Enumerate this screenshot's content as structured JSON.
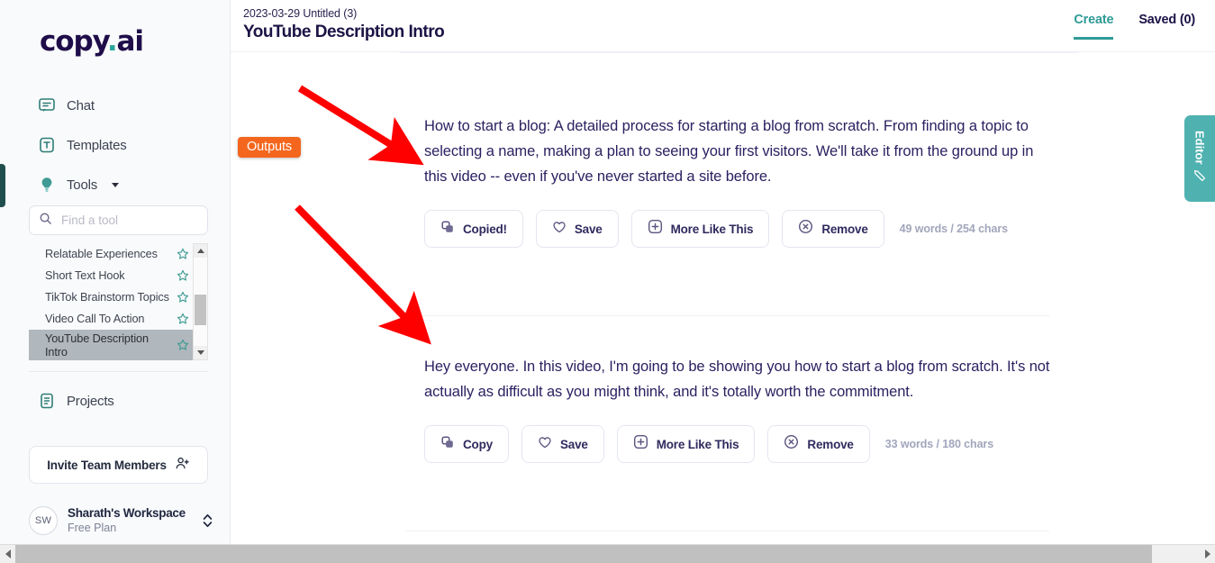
{
  "app": {
    "logo_text": "copy",
    "logo_dot": ".",
    "logo_suffix": "ai"
  },
  "sidebar": {
    "nav_items": [
      {
        "label": "Chat",
        "icon": "chat-icon"
      },
      {
        "label": "Templates",
        "icon": "templates-icon"
      },
      {
        "label": "Tools",
        "icon": "bulb-icon",
        "has_chevron": true
      }
    ],
    "search": {
      "placeholder": "Find a tool",
      "value": "",
      "icon": "search-icon"
    },
    "tools": [
      {
        "label": "Relatable Experiences",
        "favorited": false,
        "selected": false
      },
      {
        "label": "Short Text Hook",
        "favorited": false,
        "selected": false
      },
      {
        "label": "TikTok Brainstorm Topics",
        "favorited": false,
        "selected": false
      },
      {
        "label": "Video Call To Action",
        "favorited": false,
        "selected": false
      },
      {
        "label": "YouTube Description Intro",
        "favorited": false,
        "selected": true
      }
    ],
    "projects": {
      "label": "Projects",
      "icon": "document-icon"
    },
    "invite": {
      "label": "Invite Team Members",
      "icon": "add-user-icon"
    },
    "workspace": {
      "initials": "SW",
      "name": "Sharath's Workspace",
      "plan": "Free Plan"
    }
  },
  "header": {
    "doc_meta": "2023-03-29 Untitled (3)",
    "doc_title": "YouTube Description Intro",
    "tabs": [
      {
        "label": "Create",
        "active": true
      },
      {
        "label": "Saved (0)",
        "active": false
      }
    ]
  },
  "annotations": {
    "outputs_badge": "Outputs",
    "badge_color": "#f4661e",
    "arrow_color": "#ff0000"
  },
  "editor_panel": {
    "label": "Editor",
    "icon": "pencil-icon",
    "color": "#4fb2b0"
  },
  "outputs": [
    {
      "text": "How to start a blog: A detailed process for starting a blog from scratch. From finding a topic to selecting a name, making a plan to seeing your first visitors. We'll take it from the ground up in this video -- even if you've never started a site before.",
      "buttons": [
        {
          "label": "Copied!",
          "icon": "copy-icon"
        },
        {
          "label": "Save",
          "icon": "heart-icon"
        },
        {
          "label": "More Like This",
          "icon": "plus-square-icon"
        },
        {
          "label": "Remove",
          "icon": "close-circle-icon"
        }
      ],
      "stats": "49 words / 254 chars"
    },
    {
      "text": "Hey everyone. In this video, I'm going to be showing you how to start a blog from scratch. It's not actually as difficult as you might think, and it's totally worth the commitment.",
      "buttons": [
        {
          "label": "Copy",
          "icon": "copy-icon"
        },
        {
          "label": "Save",
          "icon": "heart-icon"
        },
        {
          "label": "More Like This",
          "icon": "plus-square-icon"
        },
        {
          "label": "Remove",
          "icon": "close-circle-icon"
        }
      ],
      "stats": "33 words / 180 chars"
    }
  ]
}
